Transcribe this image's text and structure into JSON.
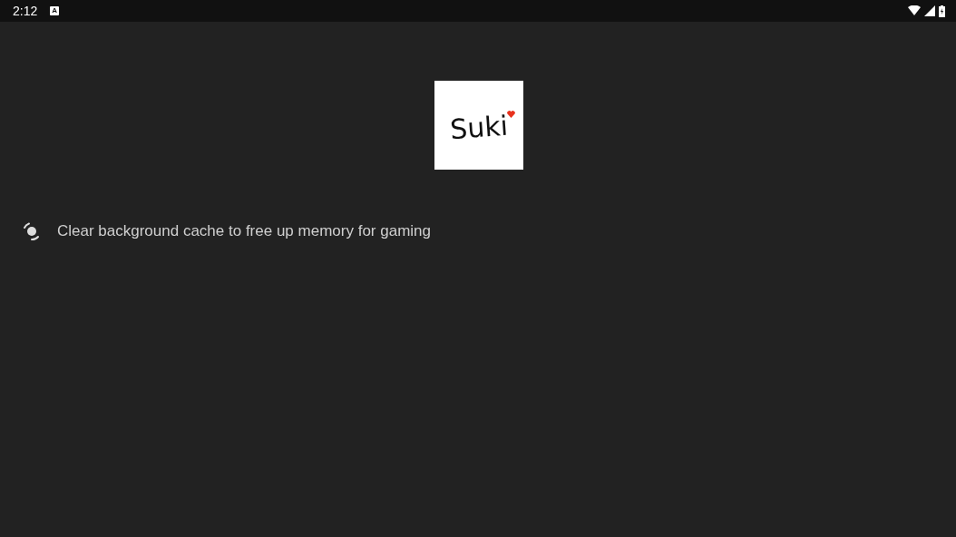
{
  "status_bar": {
    "time": "2:12",
    "notification_glyph": "A"
  },
  "logo": {
    "text": "Suki"
  },
  "tip": {
    "text": "Clear background cache to free up memory for gaming"
  }
}
